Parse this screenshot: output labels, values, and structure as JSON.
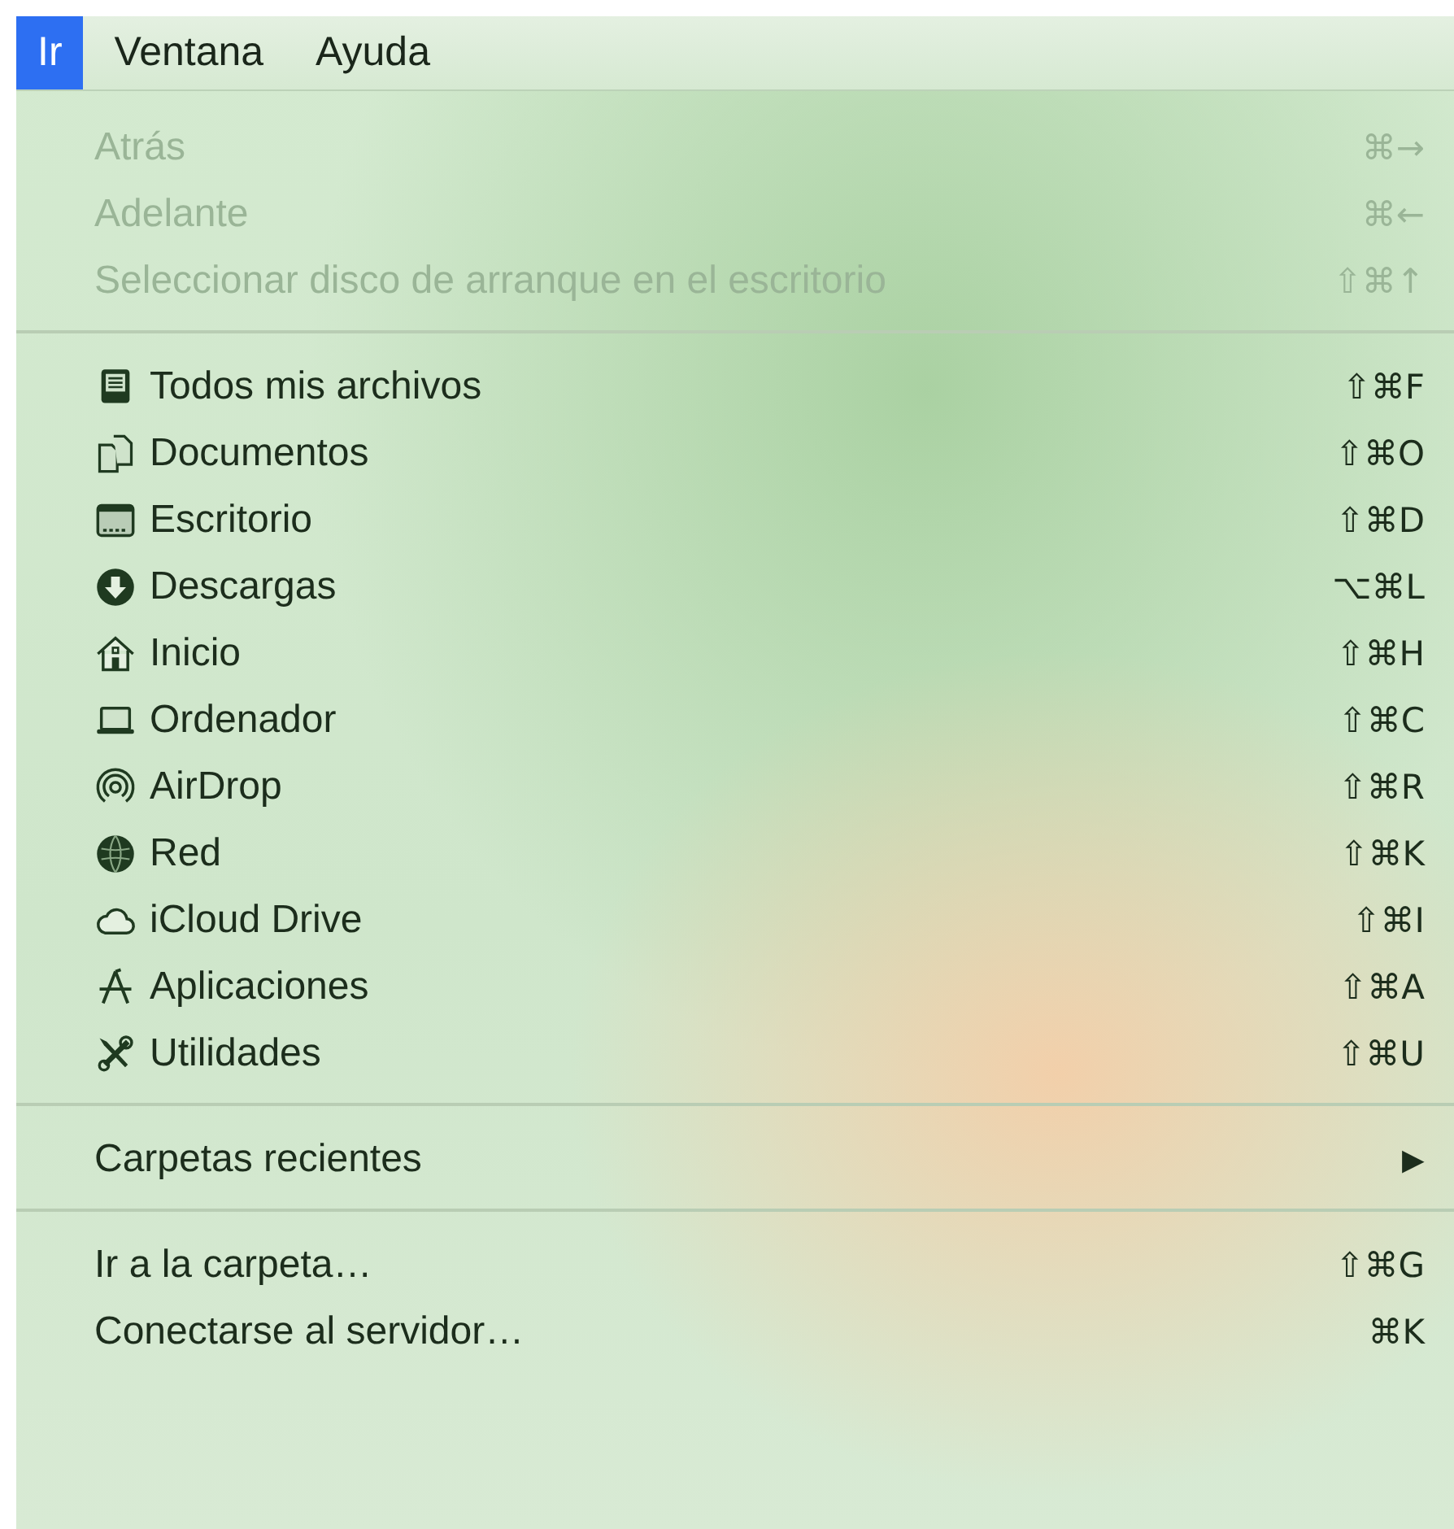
{
  "menu_bar": [
    {
      "label": "Ir",
      "selected": true
    },
    {
      "label": "Ventana",
      "selected": false
    },
    {
      "label": "Ayuda",
      "selected": false
    }
  ],
  "menu": {
    "sections": [
      {
        "items": [
          {
            "kind": "plain",
            "label": "Atrás",
            "shortcut": "⌘→",
            "disabled": true
          },
          {
            "kind": "plain",
            "label": "Adelante",
            "shortcut": "⌘←",
            "disabled": true
          },
          {
            "kind": "plain",
            "label": "Seleccionar disco de arranque en el escritorio",
            "shortcut": "⇧⌘↑",
            "disabled": true
          }
        ]
      },
      {
        "items": [
          {
            "kind": "icon",
            "label": "Todos mis archivos",
            "shortcut": "⇧⌘F",
            "disabled": false
          },
          {
            "kind": "icon",
            "label": "Documentos",
            "shortcut": "⇧⌘O",
            "disabled": false
          },
          {
            "kind": "icon",
            "label": "Escritorio",
            "shortcut": "⇧⌘D",
            "disabled": false
          },
          {
            "kind": "icon",
            "label": "Descargas",
            "shortcut": "⌥⌘L",
            "disabled": false
          },
          {
            "kind": "icon",
            "label": "Inicio",
            "shortcut": "⇧⌘H",
            "disabled": false
          },
          {
            "kind": "icon",
            "label": "Ordenador",
            "shortcut": "⇧⌘C",
            "disabled": false
          },
          {
            "kind": "icon",
            "label": "AirDrop",
            "shortcut": "⇧⌘R",
            "disabled": false
          },
          {
            "kind": "icon",
            "label": "Red",
            "shortcut": "⇧⌘K",
            "disabled": false
          },
          {
            "kind": "icon",
            "label": "iCloud Drive",
            "shortcut": "⇧⌘I",
            "disabled": false
          },
          {
            "kind": "icon",
            "label": "Aplicaciones",
            "shortcut": "⇧⌘A",
            "disabled": false
          },
          {
            "kind": "icon",
            "label": "Utilidades",
            "shortcut": "⇧⌘U",
            "disabled": false
          }
        ]
      },
      {
        "items": [
          {
            "kind": "submenu",
            "label": "Carpetas recientes",
            "arrow": "▶",
            "disabled": false
          }
        ]
      },
      {
        "items": [
          {
            "kind": "plain",
            "label": "Ir a la carpeta…",
            "shortcut": "⇧⌘G",
            "disabled": false
          },
          {
            "kind": "plain",
            "label": "Conectarse al servidor…",
            "shortcut": "⌘K",
            "disabled": false
          }
        ]
      }
    ]
  }
}
